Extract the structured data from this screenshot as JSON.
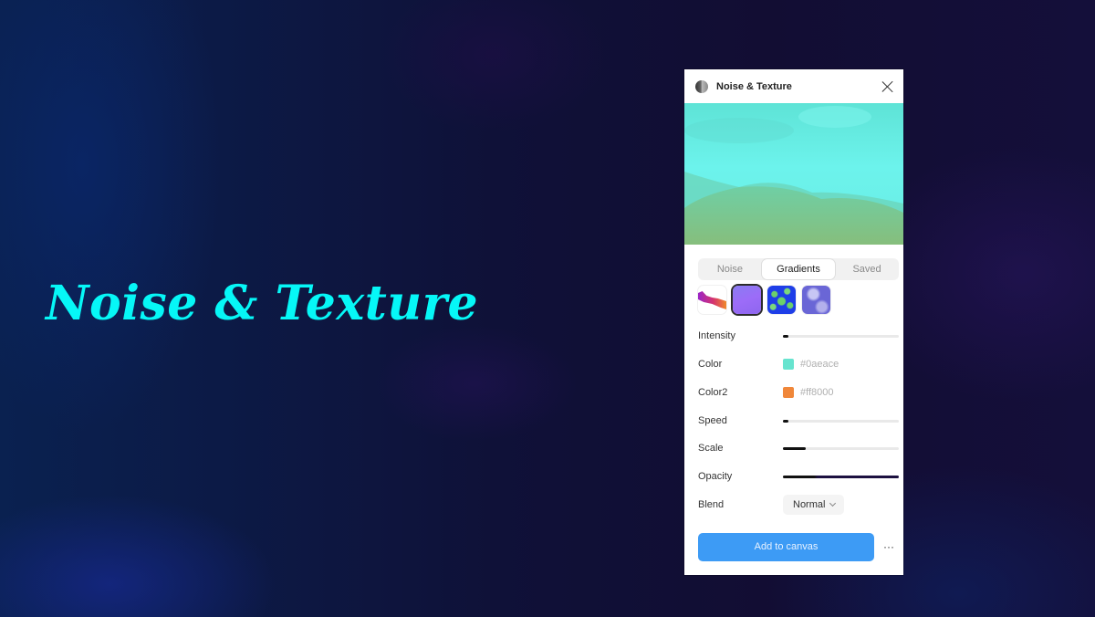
{
  "hero": {
    "title": "Noise & Texture",
    "title_color": "#06f7f7"
  },
  "panel": {
    "title": "Noise & Texture",
    "icon": "plugin-logo-icon",
    "close_icon": "close-icon",
    "tabs": [
      {
        "label": "Noise",
        "active": false
      },
      {
        "label": "Gradients",
        "active": true
      },
      {
        "label": "Saved",
        "active": false
      }
    ],
    "presets": [
      {
        "name": "orange-purple-wave",
        "selected": false
      },
      {
        "name": "violet-gradient",
        "selected": true
      },
      {
        "name": "blue-green-noise",
        "selected": false
      },
      {
        "name": "lavender-clouds",
        "selected": false
      }
    ],
    "controls": {
      "intensity": {
        "label": "Intensity",
        "value_fraction": 0.05
      },
      "color": {
        "label": "Color",
        "value": "#0aeace",
        "swatch": "#67e4cf"
      },
      "color2": {
        "label": "Color2",
        "value": "#ff8000",
        "swatch": "#f0873a"
      },
      "speed": {
        "label": "Speed",
        "value_fraction": 0.05
      },
      "scale": {
        "label": "Scale",
        "value_fraction": 0.2
      },
      "opacity": {
        "label": "Opacity",
        "value_fraction": 1.0
      },
      "blend": {
        "label": "Blend",
        "value": "Normal"
      }
    },
    "add_button": "Add to canvas",
    "more_button": "···",
    "accent_color": "#3d9bf5"
  }
}
